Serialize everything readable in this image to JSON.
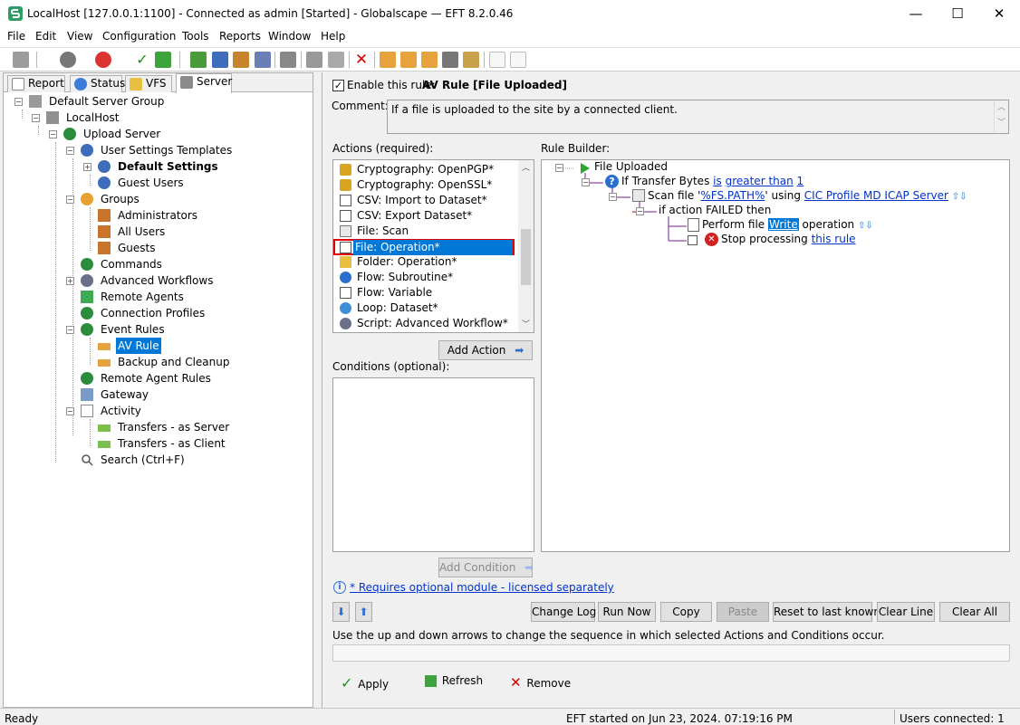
{
  "window": {
    "title": "LocalHost [127.0.0.1:1100] - Connected as admin [Started] - Globalscape — EFT 8.2.0.46",
    "controls": {
      "minimize": "—",
      "maximize": "☐",
      "close": "✕"
    }
  },
  "menu": [
    "File",
    "Edit",
    "View",
    "Configuration",
    "Tools",
    "Reports",
    "Window",
    "Help"
  ],
  "tabs": [
    {
      "label": "Report",
      "icon": "report-icon"
    },
    {
      "label": "Status",
      "icon": "status-icon"
    },
    {
      "label": "VFS",
      "icon": "vfs-icon"
    },
    {
      "label": "Server",
      "icon": "server-icon",
      "active": true
    }
  ],
  "tree": [
    {
      "label": "Default Server Group",
      "icon": "server-group-icon"
    },
    {
      "label": "LocalHost",
      "icon": "server-icon"
    },
    {
      "label": "Upload Server",
      "icon": "globe-icon"
    },
    {
      "label": "User Settings Templates",
      "icon": "gear-icon"
    },
    {
      "label": "Default Settings",
      "icon": "gear-icon"
    },
    {
      "label": "Guest Users",
      "icon": "gear-icon"
    },
    {
      "label": "Groups",
      "icon": "groups-icon"
    },
    {
      "label": "Administrators",
      "icon": "users-icon"
    },
    {
      "label": "All Users",
      "icon": "users-icon"
    },
    {
      "label": "Guests",
      "icon": "users-icon"
    },
    {
      "label": "Commands",
      "icon": "globe-icon"
    },
    {
      "label": "Advanced Workflows",
      "icon": "workflow-icon"
    },
    {
      "label": "Remote Agents",
      "icon": "agent-icon"
    },
    {
      "label": "Connection Profiles",
      "icon": "globe-icon"
    },
    {
      "label": "Event Rules",
      "icon": "globe-icon"
    },
    {
      "label": "AV Rule",
      "icon": "rule-icon"
    },
    {
      "label": "Backup and Cleanup",
      "icon": "rule-icon"
    },
    {
      "label": "Remote Agent Rules",
      "icon": "globe-icon"
    },
    {
      "label": "Gateway",
      "icon": "gateway-icon"
    },
    {
      "label": "Activity",
      "icon": "activity-icon"
    },
    {
      "label": "Transfers - as Server",
      "icon": "transfer-icon"
    },
    {
      "label": "Transfers - as Client",
      "icon": "transfer-icon"
    },
    {
      "label": "Search (Ctrl+F)",
      "icon": "search-icon"
    }
  ],
  "rule": {
    "enable_label": "Enable this rule:",
    "enabled": true,
    "name": "AV Rule [File Uploaded]",
    "comment_label": "Comment:",
    "comment": "If a file is uploaded to the site by a connected client."
  },
  "actions": {
    "label": "Actions (required):",
    "items": [
      {
        "label": "Cryptography: OpenPGP*",
        "icon": "lock-icon"
      },
      {
        "label": "Cryptography: OpenSSL*",
        "icon": "lock-icon"
      },
      {
        "label": "CSV: Import to Dataset*",
        "icon": "csv-icon"
      },
      {
        "label": "CSV: Export Dataset*",
        "icon": "csv-icon"
      },
      {
        "label": "File: Scan",
        "icon": "scan-icon"
      },
      {
        "label": "File: Operation*",
        "icon": "file-icon",
        "selected": true
      },
      {
        "label": "Folder: Operation*",
        "icon": "folder-icon"
      },
      {
        "label": "Flow: Subroutine*",
        "icon": "flow-icon"
      },
      {
        "label": "Flow: Variable",
        "icon": "variable-icon"
      },
      {
        "label": "Loop: Dataset*",
        "icon": "loop-icon"
      },
      {
        "label": "Script: Advanced Workflow*",
        "icon": "script-icon"
      }
    ],
    "add_button": "Add Action"
  },
  "conditions": {
    "label": "Conditions (optional):",
    "add_button": "Add Condition"
  },
  "rule_builder": {
    "label": "Rule Builder:",
    "trigger": "File Uploaded",
    "if_prefix": "If Transfer Bytes",
    "if_op_pre": "is",
    "if_op": "greater than",
    "if_value": "1",
    "scan_prefix": "Scan file '",
    "scan_var": "%FS.PATH%",
    "scan_mid": "' using",
    "scan_profile": "CIC Profile MD ICAP Server",
    "failed": "if action FAILED then",
    "perform_prefix": "Perform file",
    "perform_op": "Write",
    "perform_suffix": "operation",
    "stop_prefix": "Stop processing",
    "stop_link": "this rule"
  },
  "footnote": "* Requires optional module - licensed separately",
  "buttons": {
    "change_log": "Change Log",
    "run_now": "Run Now",
    "copy": "Copy",
    "paste": "Paste",
    "reset": "Reset to last known",
    "clear_line": "Clear Line",
    "clear_all": "Clear All"
  },
  "hint": "Use the up and down arrows to change the sequence in which selected Actions and Conditions occur.",
  "bottom_buttons": {
    "apply": "Apply",
    "refresh": "Refresh",
    "remove": "Remove"
  },
  "status": {
    "left": "Ready",
    "center": "EFT started on Jun 23, 2024. 07:19:16 PM",
    "right": "Users connected: 1"
  },
  "colors": {
    "selection": "#0078d7",
    "highlight_border": "#e00000",
    "link": "#0033cc"
  }
}
